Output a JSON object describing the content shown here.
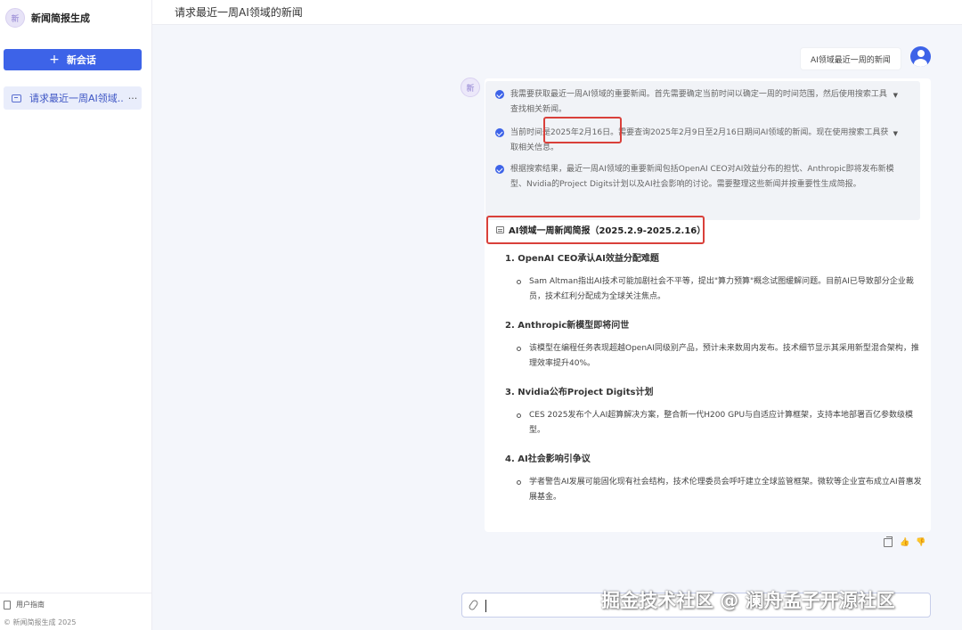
{
  "sidebar": {
    "logo_glyph": "新",
    "app_title": "新闻简报生成",
    "new_chat_label": "新会话",
    "conversations": [
      {
        "label": "请求最近一周AI领域...",
        "more": "···"
      }
    ],
    "footer": {
      "guide_label": "用户指南",
      "copyright": "© 新闻简报生成 2025"
    }
  },
  "header": {
    "title": "请求最近一周AI领域的新闻"
  },
  "chat": {
    "user_message": "AI领域最近一周的新闻",
    "bot_avatar_glyph": "新",
    "thinking_steps": [
      {
        "text": "我需要获取最近一周AI领域的重要新闻。首先需要确定当前时间以确定一周的时间范围，然后使用搜索工具查找相关新闻。",
        "collapsible": true
      },
      {
        "text": "当前时间是2025年2月16日。需要查询2025年2月9日至2月16日期间AI领域的新闻。现在使用搜索工具获取相关信息。",
        "collapsible": true
      },
      {
        "text": "根据搜索结果，最近一周AI领域的重要新闻包括OpenAI CEO对AI效益分布的担忧、Anthropic即将发布新模型、Nvidia的Project Digits计划以及AI社会影响的讨论。需要整理这些新闻并按重要性生成简报。",
        "collapsible": false
      }
    ],
    "report": {
      "title": "AI领域一周新闻简报（2025.2.9-2025.2.16）",
      "items": [
        {
          "heading": "1. OpenAI CEO承认AI效益分配难题",
          "body": "Sam Altman指出AI技术可能加剧社会不平等，提出\"算力预算\"概念试图缓解问题。目前AI已导致部分企业裁员，技术红利分配成为全球关注焦点。"
        },
        {
          "heading": "2. Anthropic新模型即将问世",
          "body": "该模型在编程任务表现超越OpenAI同级别产品，预计未来数周内发布。技术细节显示其采用新型混合架构，推理效率提升40%。"
        },
        {
          "heading": "3. Nvidia公布Project Digits计划",
          "body": "CES 2025发布个人AI超算解决方案，整合新一代H200 GPU与自适应计算框架，支持本地部署百亿参数级模型。"
        },
        {
          "heading": "4. AI社会影响引争议",
          "body": "学者警告AI发展可能固化现有社会结构，技术伦理委员会呼吁建立全球监管框架。微软等企业宣布成立AI普惠发展基金。"
        }
      ]
    }
  },
  "input": {
    "value": ""
  },
  "watermark": "掘金技术社区 @ 澜舟孟子开源社区",
  "colors": {
    "accent": "#3d63e8",
    "highlight": "#d9403a"
  }
}
